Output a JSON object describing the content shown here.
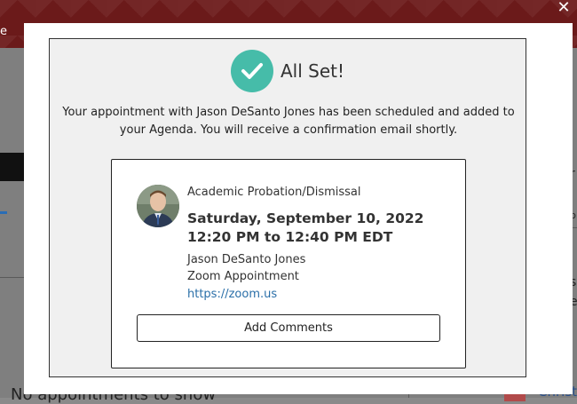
{
  "modal": {
    "title": "All Set!",
    "message": "Your appointment with Jason DeSanto Jones has been scheduled and added to your Agenda. You will receive a confirmation email shortly.",
    "close_icon": "close-icon",
    "check_icon": "checkmark-circle-icon",
    "accent_color": "#46bca9"
  },
  "appointment": {
    "type": "Academic Probation/Dismissal",
    "date": "Saturday, September 10, 2022",
    "time": "12:20 PM to 12:40 PM EDT",
    "advisor": "Jason DeSanto Jones",
    "location": "Zoom Appointment",
    "link": "https://zoom.us",
    "add_comments_label": "Add Comments"
  },
  "background": {
    "header_letter": "e",
    "empty_text": "No appointments to show",
    "right_name": "Christ",
    "right_fragments": [
      "r",
      "b",
      "s",
      "e"
    ]
  }
}
